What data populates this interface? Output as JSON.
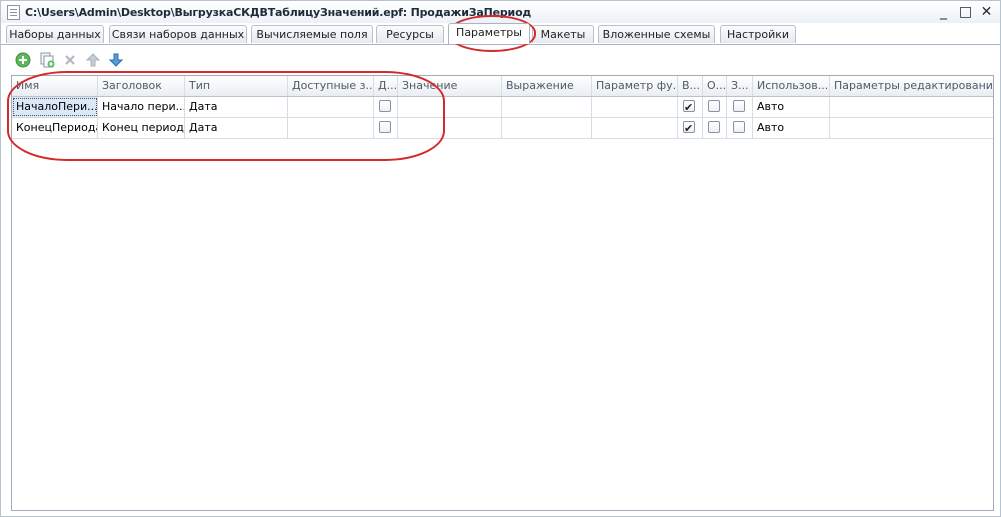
{
  "window": {
    "title": "C:\\Users\\Admin\\Desktop\\ВыгрузкаСКДВТаблицуЗначений.epf: ПродажиЗаПериод",
    "min_label": "_",
    "max_label": "□",
    "close_label": "✕"
  },
  "tabs": [
    {
      "label": "Наборы данных"
    },
    {
      "label": "Связи наборов данных"
    },
    {
      "label": "Вычисляемые поля"
    },
    {
      "label": "Ресурсы"
    },
    {
      "label": "Параметры",
      "active": true
    },
    {
      "label": "Макеты"
    },
    {
      "label": "Вложенные схемы"
    },
    {
      "label": "Настройки"
    }
  ],
  "toolbar": {
    "icons": [
      "add-icon",
      "copy-icon",
      "delete-icon",
      "move-up-icon",
      "move-down-icon"
    ]
  },
  "table": {
    "columns": [
      "Имя",
      "Заголовок",
      "Тип",
      "Доступные з...",
      "Д...",
      "Значение",
      "Выражение",
      "Параметр фу...",
      "В...",
      "О...",
      "З...",
      "Использов...",
      "Параметры редактирования"
    ],
    "rows": [
      {
        "name": "НачалоПери...",
        "title": "Начало пери...",
        "type": "Дата",
        "available": "",
        "list": false,
        "value": "",
        "expression": "",
        "func_param": "",
        "include": true,
        "limit": false,
        "fill": false,
        "use": "Авто",
        "edit_params": ""
      },
      {
        "name": "КонецПериода",
        "title": "Конец периода",
        "type": "Дата",
        "available": "",
        "list": false,
        "value": "",
        "expression": "",
        "func_param": "",
        "include": true,
        "limit": false,
        "fill": false,
        "use": "Авто",
        "edit_params": ""
      }
    ]
  },
  "colors": {
    "annotation": "#d42a2a",
    "selection": "#dbe8f8",
    "border": "#a0acbb"
  }
}
